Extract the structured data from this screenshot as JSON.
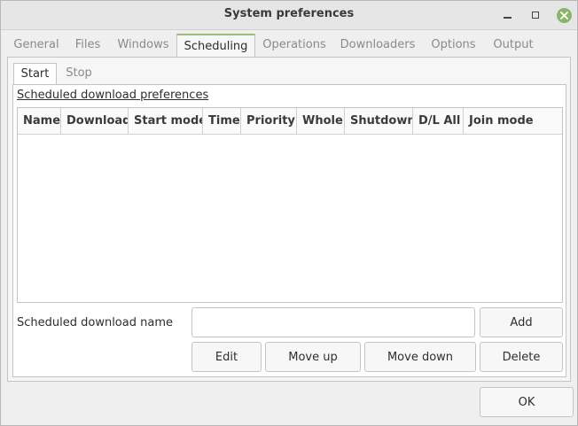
{
  "window": {
    "title": "System preferences"
  },
  "outer_tabs": [
    {
      "label": "General"
    },
    {
      "label": "Files"
    },
    {
      "label": "Windows"
    },
    {
      "label": "Scheduling"
    },
    {
      "label": "Operations"
    },
    {
      "label": "Downloaders"
    },
    {
      "label": "Options"
    },
    {
      "label": "Output"
    }
  ],
  "active_outer_tab": "Scheduling",
  "inner_tabs": [
    {
      "label": "Start"
    },
    {
      "label": "Stop"
    }
  ],
  "active_inner_tab": "Start",
  "scheduling": {
    "section_title": "Scheduled download preferences",
    "columns": [
      "Name",
      "Download",
      "Start mode",
      "Time",
      "Priority",
      "Whole",
      "Shutdown",
      "D/L All",
      "Join mode"
    ],
    "rows": [],
    "name_label": "Scheduled download name",
    "name_value": "",
    "buttons": {
      "add": "Add",
      "edit": "Edit",
      "move_up": "Move up",
      "move_down": "Move down",
      "delete": "Delete"
    }
  },
  "footer": {
    "ok_label": "OK"
  },
  "colors": {
    "accent": "#9ebc78",
    "close_button": "#8ab56b"
  }
}
